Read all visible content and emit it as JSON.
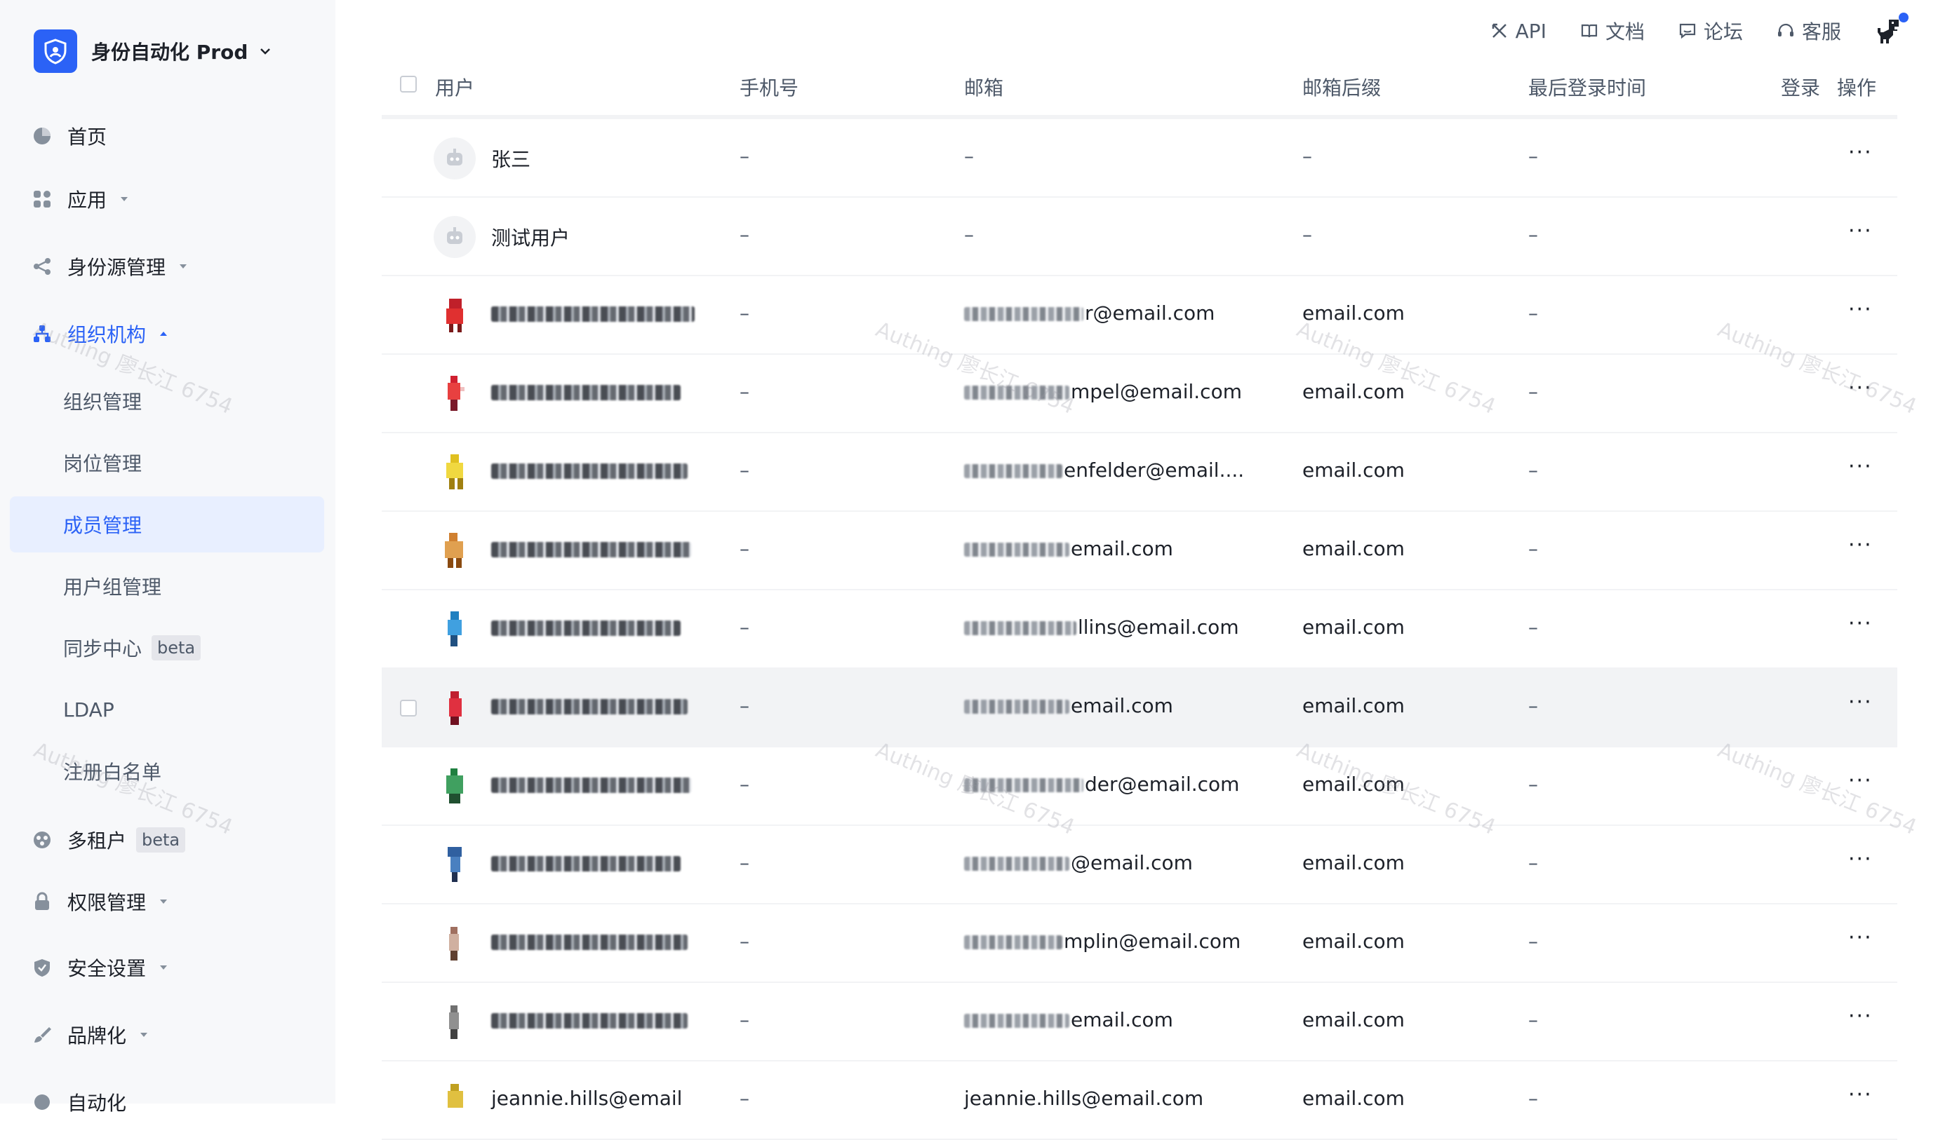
{
  "app": {
    "org_name": "身份自动化 Prod"
  },
  "sidebar": {
    "nav": [
      {
        "label": "首页",
        "icon": "pie-chart-icon"
      },
      {
        "label": "应用",
        "icon": "apps-grid-icon"
      },
      {
        "label": "身份源管理",
        "icon": "share-icon"
      },
      {
        "label": "组织机构",
        "icon": "org-tree-icon"
      }
    ],
    "org_sub": [
      {
        "label": "组织管理"
      },
      {
        "label": "岗位管理"
      },
      {
        "label": "成员管理"
      },
      {
        "label": "用户组管理"
      },
      {
        "label": "同步中心",
        "badge": "beta"
      },
      {
        "label": "LDAP"
      },
      {
        "label": "注册白名单"
      }
    ],
    "nav2": [
      {
        "label": "多租户",
        "badge": "beta",
        "icon": "tenant-icon"
      },
      {
        "label": "权限管理",
        "icon": "lock-icon"
      },
      {
        "label": "安全设置",
        "icon": "shield-check-icon"
      },
      {
        "label": "品牌化",
        "icon": "brush-icon"
      },
      {
        "label": "自动化",
        "icon": "automation-icon"
      }
    ]
  },
  "topbar": {
    "api": "API",
    "docs": "文档",
    "forum": "论坛",
    "support": "客服"
  },
  "table": {
    "headers": {
      "user": "用户",
      "phone": "手机号",
      "email": "邮箱",
      "suffix": "邮箱后缀",
      "last_login": "最后登录时间",
      "login": "登录",
      "actions": "操作"
    },
    "rows": [
      {
        "name": "张三",
        "phone": "–",
        "email": "–",
        "suffix": "–",
        "last_login": "–",
        "more": "···"
      },
      {
        "name": "测试用户",
        "phone": "–",
        "email": "–",
        "suffix": "–",
        "last_login": "–",
        "more": "···"
      },
      {
        "name": "",
        "phone": "–",
        "email": "r@email.com",
        "suffix": "email.com",
        "last_login": "–",
        "more": "···"
      },
      {
        "name": "",
        "phone": "–",
        "email": "mpel@email.com",
        "suffix": "email.com",
        "last_login": "–",
        "more": "···"
      },
      {
        "name": "",
        "phone": "–",
        "email": "enfelder@email....",
        "suffix": "email.com",
        "last_login": "–",
        "more": "···"
      },
      {
        "name": "",
        "phone": "–",
        "email": "email.com",
        "suffix": "email.com",
        "last_login": "–",
        "more": "···"
      },
      {
        "name": "",
        "phone": "–",
        "email": "llins@email.com",
        "suffix": "email.com",
        "last_login": "–",
        "more": "···"
      },
      {
        "name": "",
        "phone": "–",
        "email": "email.com",
        "suffix": "email.com",
        "last_login": "–",
        "more": "···"
      },
      {
        "name": "",
        "phone": "–",
        "email": "der@email.com",
        "suffix": "email.com",
        "last_login": "–",
        "more": "···"
      },
      {
        "name": "",
        "phone": "–",
        "email": "@email.com",
        "suffix": "email.com",
        "last_login": "–",
        "more": "···"
      },
      {
        "name": "",
        "phone": "–",
        "email": "mplin@email.com",
        "suffix": "email.com",
        "last_login": "–",
        "more": "···"
      },
      {
        "name": "",
        "phone": "–",
        "email": "email.com",
        "suffix": "email.com",
        "last_login": "–",
        "more": "···"
      },
      {
        "name": "jeannie.hills@email",
        "phone": "–",
        "email": "jeannie.hills@email.com",
        "suffix": "email.com",
        "last_login": "–",
        "more": "···"
      }
    ]
  },
  "watermark": "Authing 廖长江 6754",
  "colors": {
    "primary": "#2b62f6",
    "sidebar_bg": "#f7f8fa",
    "active_bg": "#e8efff"
  }
}
